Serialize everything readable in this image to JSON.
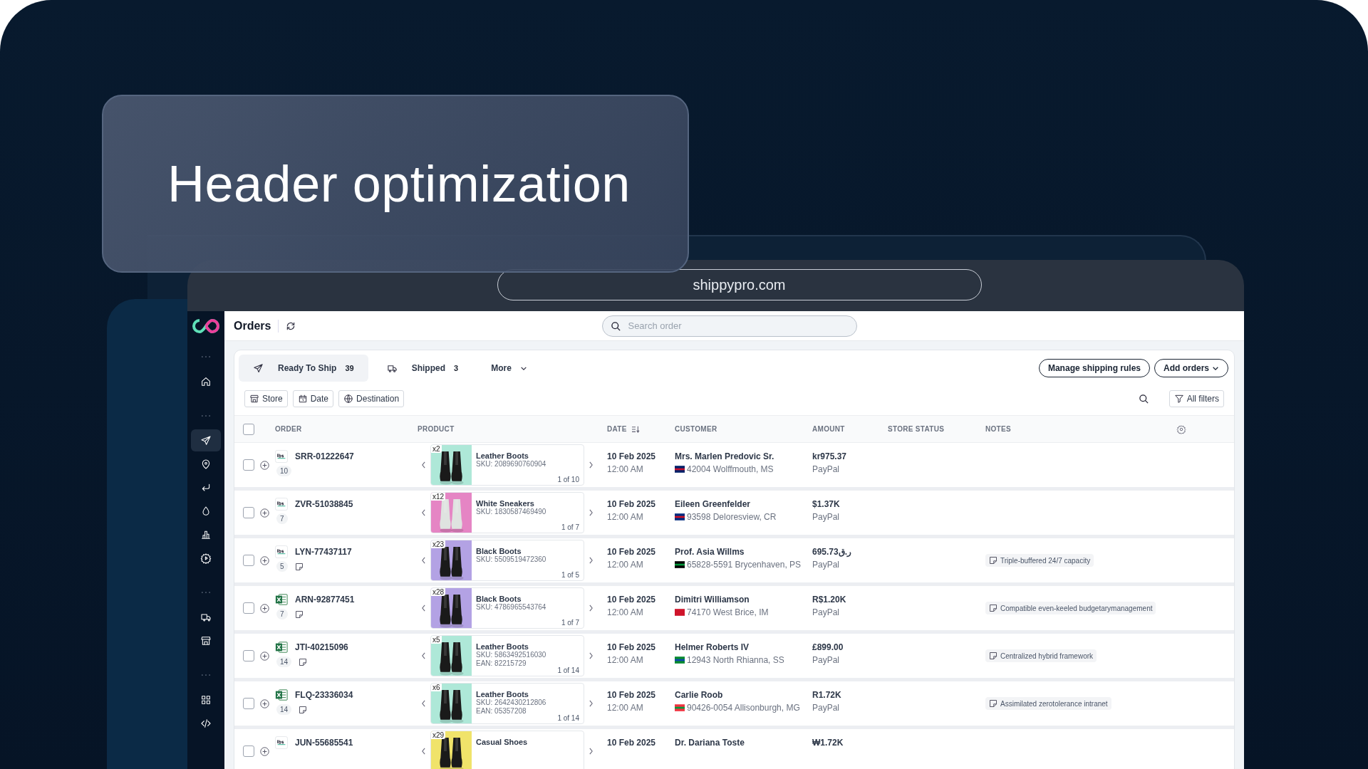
{
  "banner": {
    "title": "Header optimization"
  },
  "browser": {
    "url": "shippypro.com"
  },
  "header": {
    "title": "Orders",
    "search": {
      "placeholder": "Search order"
    }
  },
  "sidebar": {
    "items": [
      {
        "kind": "dots"
      },
      {
        "kind": "home",
        "selected": false
      },
      {
        "kind": "dots"
      },
      {
        "kind": "send",
        "selected": true
      },
      {
        "kind": "pin",
        "selected": false
      },
      {
        "kind": "return",
        "selected": false
      },
      {
        "kind": "drop",
        "selected": false
      },
      {
        "kind": "chart",
        "selected": false
      },
      {
        "kind": "gear",
        "selected": false
      },
      {
        "kind": "dots"
      },
      {
        "kind": "truck",
        "selected": false
      },
      {
        "kind": "store",
        "selected": false
      },
      {
        "kind": "dots"
      },
      {
        "kind": "grid",
        "selected": false
      },
      {
        "kind": "code",
        "selected": false
      }
    ]
  },
  "tabs": [
    {
      "kind": "send",
      "label": "Ready To Ship",
      "count": "39",
      "selected": true
    },
    {
      "kind": "truck",
      "label": "Shipped",
      "count": "3",
      "selected": false
    },
    {
      "kind": "more",
      "label": "More",
      "selected": false
    }
  ],
  "actions": [
    {
      "label": "Manage shipping rules",
      "kind": "plain"
    },
    {
      "label": "Add orders",
      "kind": "dropdown"
    }
  ],
  "filters": [
    {
      "kind": "store",
      "label": "Store"
    },
    {
      "kind": "date",
      "label": "Date"
    },
    {
      "kind": "globe",
      "label": "Destination"
    }
  ],
  "all_filters": "All filters",
  "table": {
    "select_all": {
      "checked": false
    },
    "columns": [
      "ORDER",
      "PRODUCT",
      "DATE",
      "CUSTOMER",
      "AMOUNT",
      "STORE STATUS",
      "NOTES"
    ],
    "rows": [
      {
        "kind": "ibs",
        "checked": false,
        "order": "SRR-01222647",
        "count": "10",
        "has_note": false,
        "qty": "x2",
        "product": "Leather Boots",
        "sku": "SKU: 2089690760904",
        "pager": "1 of 10",
        "date": "10 Feb 2025",
        "time": "12:00 AM",
        "customer": "Mrs. Marlen Predovic Sr.",
        "address": "42004 Wolffmouth, MS",
        "amount": "kr975.37",
        "payment": "PayPal"
      },
      {
        "kind": "ibs",
        "checked": false,
        "order": "ZVR-51038845",
        "count": "7",
        "has_note": false,
        "qty": "x12",
        "product": "White Sneakers",
        "sku": "SKU: 1830587469490",
        "pager": "1 of 7",
        "date": "10 Feb 2025",
        "time": "12:00 AM",
        "customer": "Eileen Greenfelder",
        "address": "93598 Deloresview, CR",
        "amount": "$1.37K",
        "payment": "PayPal"
      },
      {
        "kind": "ibs",
        "checked": false,
        "order": "LYN-77437117",
        "count": "5",
        "has_note": true,
        "qty": "x23",
        "product": "Black Boots",
        "sku": "SKU: 5509519472360",
        "pager": "1 of 5",
        "date": "10 Feb 2025",
        "time": "12:00 AM",
        "customer": "Prof. Asia Willms",
        "address": "65828-5591 Brycenhaven, PS",
        "amount": "695.73ر.ق",
        "payment": "PayPal",
        "note": "Triple-buffered 24/7 capacity"
      },
      {
        "kind": "excel",
        "checked": false,
        "order": "ARN-92877451",
        "count": "7",
        "has_note": true,
        "qty": "x28",
        "product": "Black Boots",
        "sku": "SKU: 4786965543764",
        "pager": "1 of 7",
        "date": "10 Feb 2025",
        "time": "12:00 AM",
        "customer": "Dimitri Williamson",
        "address": "74170 West Brice, IM",
        "amount": "R$1.20K",
        "payment": "PayPal",
        "note": "Compatible even-keeled budgetarymanagement"
      },
      {
        "kind": "excel",
        "checked": false,
        "order": "JTI-40215096",
        "count": "14",
        "has_note": true,
        "qty": "x5",
        "product": "Leather Boots",
        "sku": "SKU: 5863492516030",
        "ean": "EAN: 82215729",
        "pager": "1 of 14",
        "date": "10 Feb 2025",
        "time": "12:00 AM",
        "customer": "Helmer Roberts IV",
        "address": "12943 North Rhianna, SS",
        "amount": "£899.00",
        "payment": "PayPal",
        "note": "Centralized hybrid framework"
      },
      {
        "kind": "excel",
        "checked": false,
        "order": "FLQ-23336034",
        "count": "14",
        "has_note": true,
        "qty": "x6",
        "product": "Leather Boots",
        "sku": "SKU: 2642430212806",
        "ean": "EAN: 05357208",
        "pager": "1 of 14",
        "date": "10 Feb 2025",
        "time": "12:00 AM",
        "customer": "Carlie Roob",
        "address": "90426-0054 Allisonburgh, MG",
        "amount": "R1.72K",
        "payment": "PayPal",
        "note": "Assimilated zerotolerance intranet"
      },
      {
        "kind": "ibs",
        "checked": false,
        "order": "JUN-55685541",
        "qty": "x29",
        "product": "Casual Shoes",
        "date": "10 Feb 2025",
        "customer": "Dr. Dariana Toste",
        "amount": "₩1.72K"
      }
    ]
  }
}
